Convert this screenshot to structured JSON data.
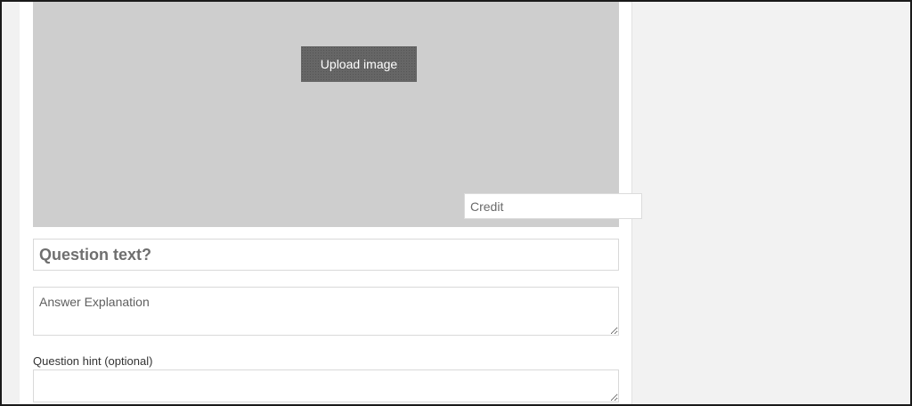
{
  "image_area": {
    "upload_button_label": "Upload image",
    "credit_placeholder": "Credit"
  },
  "question": {
    "text_placeholder": "Question text?"
  },
  "explanation": {
    "placeholder": "Answer Explanation"
  },
  "hint": {
    "label": "Question hint (optional)",
    "value": ""
  },
  "colors": {
    "image_placeholder_bg": "#cecece",
    "upload_button_bg": "#666666",
    "page_bg": "#f1f1f1",
    "panel_bg": "#ffffff"
  }
}
